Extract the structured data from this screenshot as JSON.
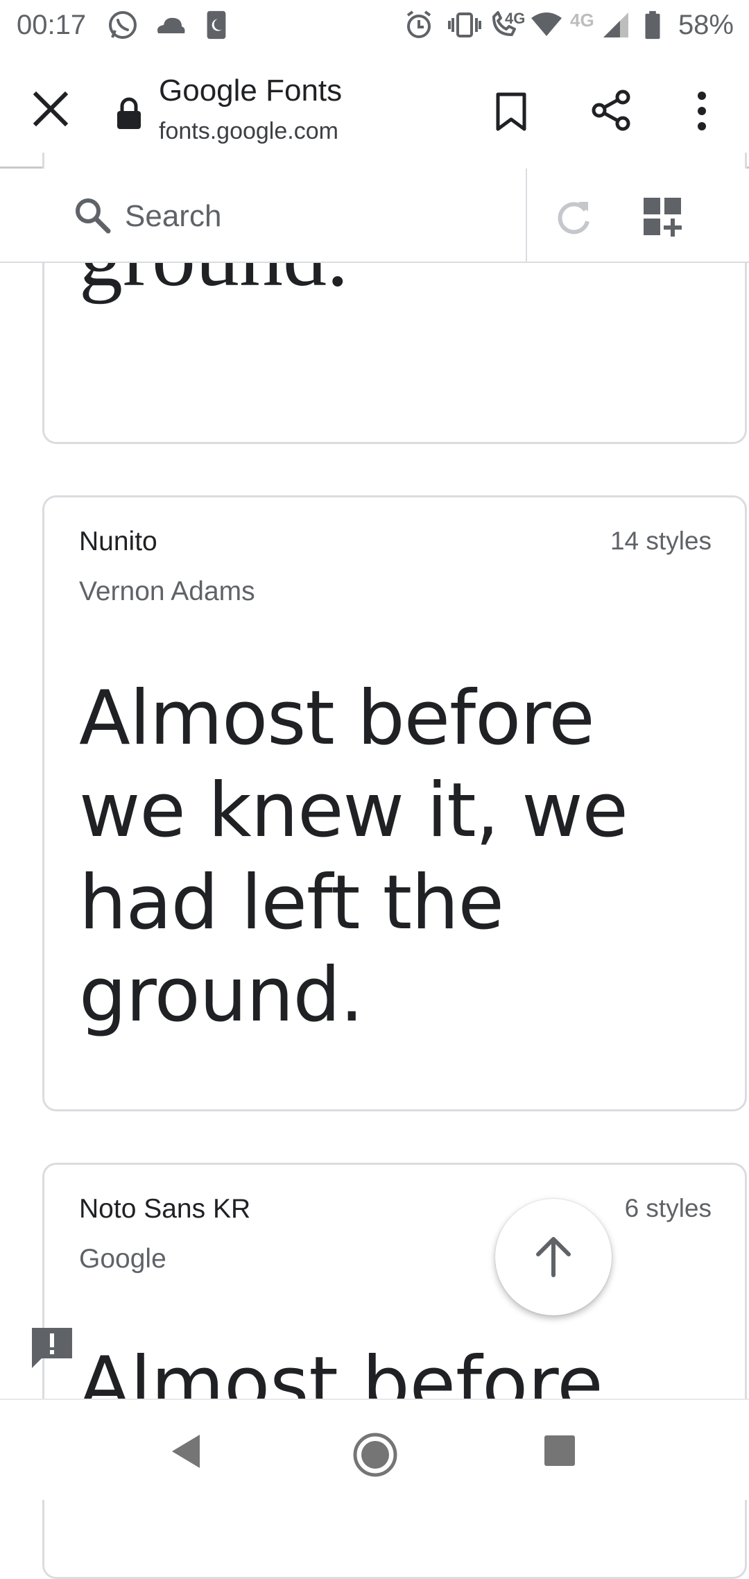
{
  "status_bar": {
    "time": "00:17",
    "battery_percent": "58%",
    "network_label_1": "4G",
    "network_label_2": "4G"
  },
  "toolbar": {
    "title": "Google Fonts",
    "url": "fonts.google.com"
  },
  "search": {
    "placeholder": "Search"
  },
  "cards": [
    {
      "sample_text_visible": "ground."
    },
    {
      "name": "Nunito",
      "author": "Vernon Adams",
      "styles": "14 styles",
      "sample_line_1": "Almost before",
      "sample_line_2": "we knew it, we",
      "sample_line_3": "had left the",
      "sample_line_4": "ground."
    },
    {
      "name": "Noto Sans KR",
      "author": "Google",
      "styles": "6 styles",
      "sample_line_1": "Almost before"
    }
  ],
  "icons": {
    "close": "close-icon",
    "lock": "lock-icon",
    "bookmark": "bookmark-icon",
    "share": "share-icon",
    "more": "more-vert-icon",
    "search": "search-icon",
    "refresh": "refresh-icon",
    "add_grid": "add-grid-icon",
    "scroll_top": "arrow-up-icon",
    "feedback": "feedback-icon"
  },
  "colors": {
    "text_primary": "#202124",
    "text_secondary": "#5f6368",
    "border": "#dadce0"
  }
}
